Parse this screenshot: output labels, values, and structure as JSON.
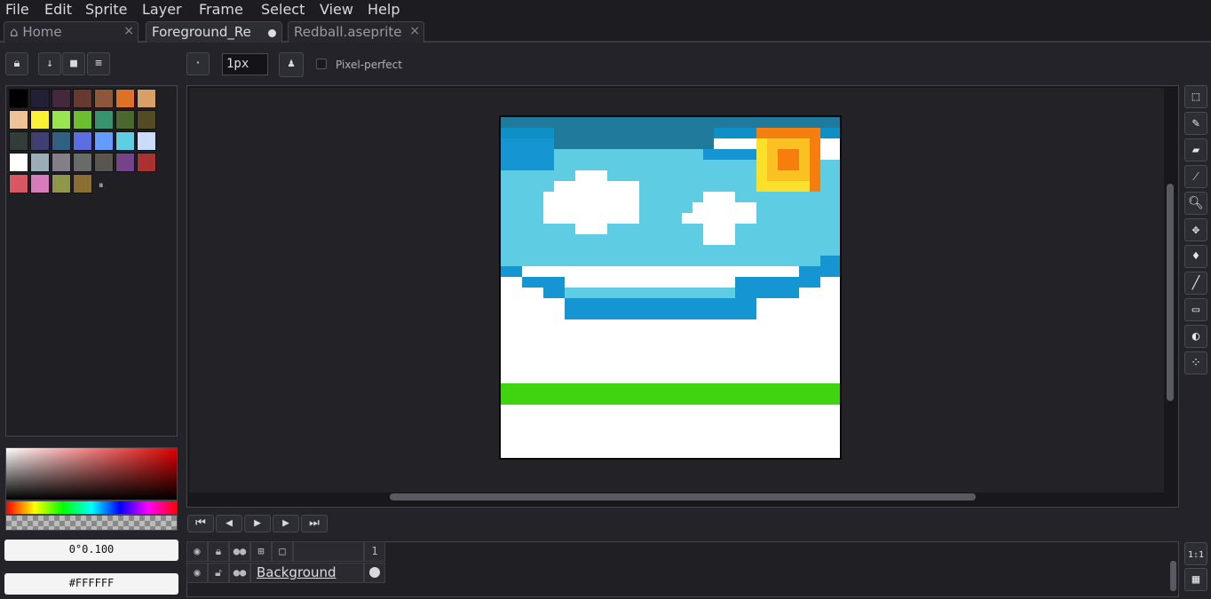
{
  "menu": [
    "File",
    "Edit",
    "Sprite",
    "Layer",
    "Frame",
    "Select",
    "View",
    "Help"
  ],
  "tabs": [
    {
      "label": "Home",
      "icon": "home-icon"
    },
    {
      "label": "Foreground_Re",
      "modified": true
    },
    {
      "label": "Redball.aseprite"
    }
  ],
  "toolbar": {
    "brush_size": "1px",
    "pixel_perfect_label": "Pixel-perfect",
    "pixel_perfect_checked": false
  },
  "palette": {
    "colors": [
      "#000000",
      "#222034",
      "#45283c",
      "#663931",
      "#8f563b",
      "#df7126",
      "#d9a066",
      "#eec39a",
      "#fbf236",
      "#99e550",
      "#6abe30",
      "#37946e",
      "#4b692f",
      "#524b24",
      "#323c39",
      "#3f3f74",
      "#306082",
      "#5b6ee1",
      "#639bff",
      "#5fcde4",
      "#cbdbfc",
      "#ffffff",
      "#9badb7",
      "#847e87",
      "#696a6a",
      "#595652",
      "#76428a",
      "#ac3232",
      "#d95763",
      "#d77bba",
      "#8f974a",
      "#8a6f30"
    ]
  },
  "color_fields": {
    "alpha_value": "0°0.100",
    "hex_value": "#FFFFFF"
  },
  "timeline": {
    "frame_number": "1",
    "layer_name": "Background"
  },
  "status": {
    "zoom_button": "1:1"
  }
}
